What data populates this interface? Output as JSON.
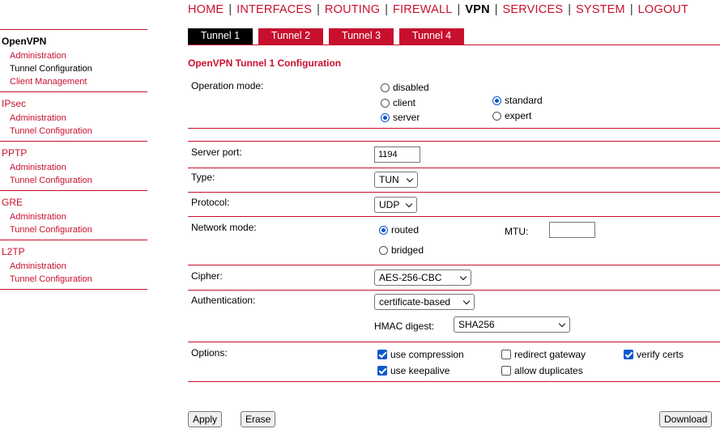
{
  "topnav": {
    "home": "HOME",
    "interfaces": "INTERFACES",
    "routing": "ROUTING",
    "firewall": "FIREWALL",
    "vpn": "VPN",
    "services": "SERVICES",
    "system": "SYSTEM",
    "logout": "LOGOUT",
    "separator": "|"
  },
  "sidebar": {
    "openvpn": {
      "title": "OpenVPN",
      "items": [
        "Administration",
        "Tunnel Configuration",
        "Client Management"
      ]
    },
    "ipsec": {
      "title": "IPsec",
      "items": [
        "Administration",
        "Tunnel Configuration"
      ]
    },
    "pptp": {
      "title": "PPTP",
      "items": [
        "Administration",
        "Tunnel Configuration"
      ]
    },
    "gre": {
      "title": "GRE",
      "items": [
        "Administration",
        "Tunnel Configuration"
      ]
    },
    "l2tp": {
      "title": "L2TP",
      "items": [
        "Administration",
        "Tunnel Configuration"
      ]
    }
  },
  "tabs": [
    "Tunnel 1",
    "Tunnel 2",
    "Tunnel 3",
    "Tunnel 4"
  ],
  "heading": "OpenVPN Tunnel 1 Configuration",
  "form": {
    "operation_mode": {
      "label": "Operation mode:",
      "opt_disabled": "disabled",
      "opt_client": "client",
      "opt_server": "server",
      "opt_standard": "standard",
      "opt_expert": "expert"
    },
    "server_port": {
      "label": "Server port:",
      "value": "1194"
    },
    "type": {
      "label": "Type:",
      "value": "TUN"
    },
    "protocol": {
      "label": "Protocol:",
      "value": "UDP"
    },
    "network_mode": {
      "label": "Network mode:",
      "opt_routed": "routed",
      "opt_bridged": "bridged",
      "mtu_label": "MTU:",
      "mtu_value": ""
    },
    "cipher": {
      "label": "Cipher:",
      "value": "AES-256-CBC"
    },
    "authentication": {
      "label": "Authentication:",
      "value": "certificate-based",
      "hmac_label": "HMAC digest:",
      "hmac_value": "SHA256"
    },
    "options": {
      "label": "Options:",
      "use_compression": "use compression",
      "redirect_gateway": "redirect gateway",
      "verify_certs": "verify certs",
      "use_keepalive": "use keepalive",
      "allow_duplicates": "allow duplicates"
    }
  },
  "buttons": {
    "apply": "Apply",
    "erase": "Erase",
    "download": "Download"
  }
}
